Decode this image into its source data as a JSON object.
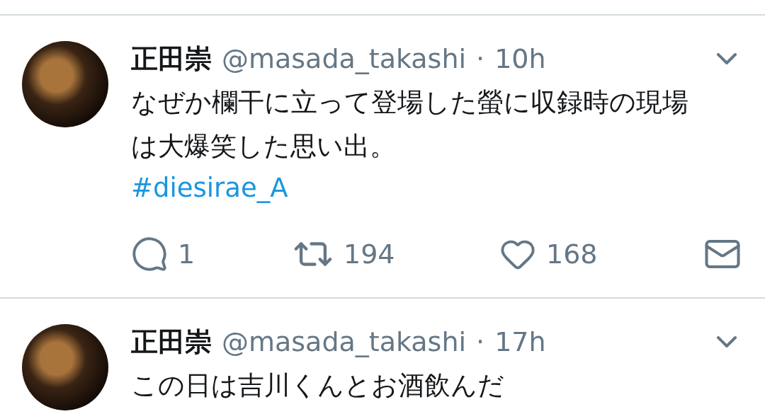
{
  "tweets": [
    {
      "name": "正田崇",
      "handle": "@masada_takashi",
      "separator": "·",
      "time": "10h",
      "text": "なぜか欄干に立って登場した螢に収録時の現場は大爆笑した思い出。",
      "hashtag": "#diesirae_A",
      "replies": "1",
      "retweets": "194",
      "likes": "168"
    },
    {
      "name": "正田崇",
      "handle": "@masada_takashi",
      "separator": "·",
      "time": "17h",
      "text": "この日は吉川くんとお酒飲んだ"
    }
  ]
}
